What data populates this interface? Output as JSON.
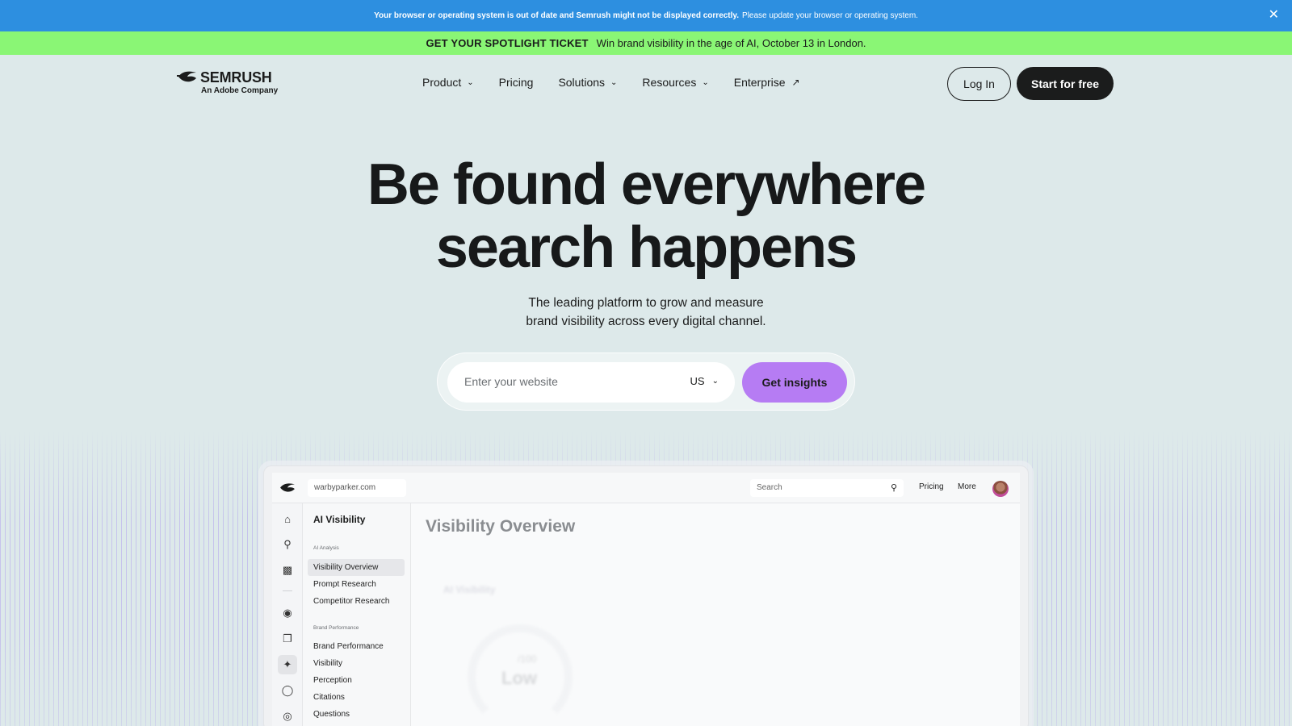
{
  "notice": {
    "bold": "Your browser or operating system is out of date and Semrush might not be displayed correctly.",
    "text": "Please update your browser or operating system.",
    "close": "✕"
  },
  "promo": {
    "headline": "GET YOUR SPOTLIGHT TICKET",
    "text": "Win brand visibility in the age of AI, October 13 in London."
  },
  "logo": {
    "name": "SEMRUSH",
    "sub": "An Adobe Company"
  },
  "nav": [
    {
      "label": "Product",
      "icon": "chevron-down-icon"
    },
    {
      "label": "Pricing"
    },
    {
      "label": "Solutions",
      "icon": "chevron-down-icon"
    },
    {
      "label": "Resources",
      "icon": "chevron-down-icon"
    },
    {
      "label": "Enterprise",
      "icon": "arrow-up-right-icon"
    }
  ],
  "header_buttons": {
    "login": "Log In",
    "start": "Start for free"
  },
  "hero": {
    "title_line1": "Be found everywhere",
    "title_line2": "search happens",
    "subtitle_line1": "The leading platform to grow and measure",
    "subtitle_line2": "brand visibility across every digital channel."
  },
  "search": {
    "placeholder": "Enter your website",
    "country": "US",
    "button": "Get insights"
  },
  "colors": {
    "notice_bg": "#2d8fe0",
    "promo_bg": "#8af675",
    "page_bg": "#dde9ea",
    "cta_purple": "#b67cf3",
    "dark": "#1b1c1c"
  },
  "app": {
    "domain": "warbyparker.com",
    "search_placeholder": "Search",
    "links": [
      "Pricing",
      "More"
    ],
    "rail_icons": [
      "home-icon",
      "search-analytics-icon",
      "bar-chart-icon",
      "location-pin-icon",
      "copy-icon",
      "ai-visibility-icon",
      "chat-icon",
      "target-search-icon"
    ],
    "sidebar": {
      "title": "AI Visibility",
      "section1": "AI Analysis",
      "section1_items": [
        "Visibility Overview",
        "Prompt Research",
        "Competitor Research"
      ],
      "section2": "Brand Performance",
      "section2_items": [
        "Brand Performance",
        "Visibility",
        "Perception",
        "Citations",
        "Questions"
      ]
    },
    "main_title": "Visibility Overview",
    "card_label": "AI Visibility",
    "score": "/100",
    "score_level": "Low"
  }
}
